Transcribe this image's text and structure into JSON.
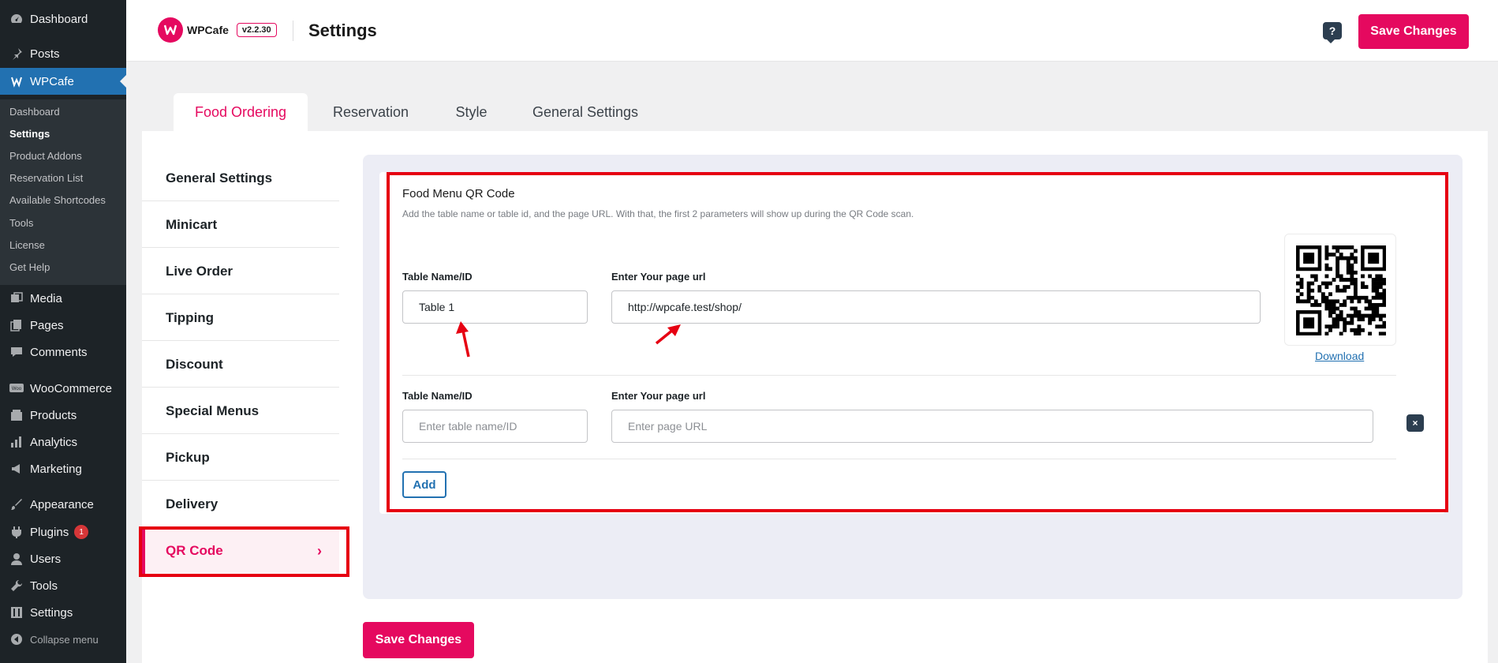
{
  "sidebar": {
    "items": [
      {
        "label": "Dashboard",
        "icon": "dashboard-icon"
      },
      {
        "label": "Posts",
        "icon": "pin-icon"
      },
      {
        "label": "WPCafe",
        "icon": "wpcafe-icon"
      },
      {
        "label": "Media",
        "icon": "media-icon"
      },
      {
        "label": "Pages",
        "icon": "pages-icon"
      },
      {
        "label": "Comments",
        "icon": "comments-icon"
      },
      {
        "label": "WooCommerce",
        "icon": "woocommerce-icon"
      },
      {
        "label": "Products",
        "icon": "products-icon"
      },
      {
        "label": "Analytics",
        "icon": "analytics-icon"
      },
      {
        "label": "Marketing",
        "icon": "marketing-icon"
      },
      {
        "label": "Appearance",
        "icon": "appearance-icon"
      },
      {
        "label": "Plugins",
        "icon": "plugins-icon",
        "badge": "1"
      },
      {
        "label": "Users",
        "icon": "users-icon"
      },
      {
        "label": "Tools",
        "icon": "tools-icon"
      },
      {
        "label": "Settings",
        "icon": "settings-icon"
      },
      {
        "label": "Collapse menu",
        "icon": "collapse-icon"
      }
    ],
    "submenu": [
      "Dashboard",
      "Settings",
      "Product Addons",
      "Reservation List",
      "Available Shortcodes",
      "Tools",
      "License",
      "Get Help"
    ]
  },
  "header": {
    "logo_text": "WPCafe",
    "version": "v2.2.30",
    "title": "Settings",
    "help_icon": "?",
    "save_label": "Save Changes"
  },
  "tabs": [
    "Food Ordering",
    "Reservation",
    "Style",
    "General Settings"
  ],
  "settings_nav": {
    "items": [
      "General Settings",
      "Minicart",
      "Live Order",
      "Tipping",
      "Discount",
      "Special Menus",
      "Pickup",
      "Delivery",
      "QR Code"
    ],
    "chevron": "›"
  },
  "qr_section": {
    "title": "Food Menu QR Code",
    "description": "Add the table name or table id, and the page URL. With that, the first 2 parameters will show up during the QR Code scan.",
    "rows": [
      {
        "table_label": "Table Name/ID",
        "url_label": "Enter Your page url",
        "table_value": "Table 1",
        "url_value": "http://wpcafe.test/shop/"
      },
      {
        "table_label": "Table Name/ID",
        "url_label": "Enter Your page url",
        "table_placeholder": "Enter table name/ID",
        "url_placeholder": "Enter page URL"
      }
    ],
    "download_label": "Download",
    "remove_icon": "×",
    "add_label": "Add"
  },
  "footer": {
    "save_label": "Save Changes"
  },
  "colors": {
    "brand": "#e5095f",
    "wp_blue": "#2271b1",
    "sidebar_bg": "#1d2327",
    "highlight": "#e60012"
  }
}
